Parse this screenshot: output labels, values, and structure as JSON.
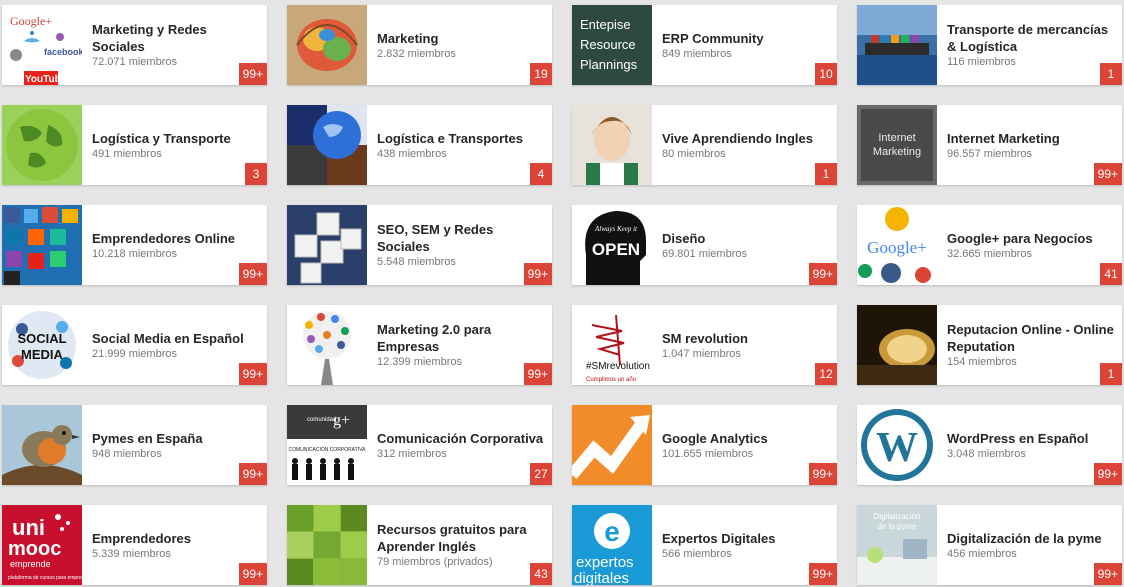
{
  "communities": [
    {
      "name": "Marketing y Redes Sociales",
      "members": "72.071 miembros",
      "badge": "99+",
      "thumb": "social-logos",
      "color": "#ffffff"
    },
    {
      "name": "Marketing",
      "members": "2.832 miembros",
      "badge": "19",
      "thumb": "colorful-brain",
      "color": "#c8a878"
    },
    {
      "name": "ERP Community",
      "members": "849 miembros",
      "badge": "10",
      "thumb": "erp-text",
      "color": "#2e4a3e"
    },
    {
      "name": "Transporte de mercancías & Logística",
      "members": "116 miembros",
      "badge": "1",
      "thumb": "cargo-ship",
      "color": "#3a6fa8"
    },
    {
      "name": "Logística y Transporte",
      "members": "491 miembros",
      "badge": "3",
      "thumb": "green-globe",
      "color": "#6aa83a"
    },
    {
      "name": "Logística e Transportes",
      "members": "438 miembros",
      "badge": "4",
      "thumb": "globe-collage",
      "color": "#3b5aa8"
    },
    {
      "name": "Vive Aprendiendo Ingles",
      "members": "80 miembros",
      "badge": "1",
      "thumb": "woman-portrait",
      "color": "#d9c3a5"
    },
    {
      "name": "Internet Marketing",
      "members": "96.557 miembros",
      "badge": "99+",
      "thumb": "chalkboard",
      "color": "#5a5a5a"
    },
    {
      "name": "Emprendedores Online",
      "members": "10.218 miembros",
      "badge": "99+",
      "thumb": "social-icons",
      "color": "#2a7fc8"
    },
    {
      "name": "SEO, SEM y Redes Sociales",
      "members": "5.548 miembros",
      "badge": "99+",
      "thumb": "cubes",
      "color": "#2b3f6b"
    },
    {
      "name": "Diseño",
      "members": "69.801 miembros",
      "badge": "99+",
      "thumb": "head-open",
      "color": "#ffffff"
    },
    {
      "name": "Google+ para Negocios",
      "members": "32.665 miembros",
      "badge": "41",
      "thumb": "google-plus",
      "color": "#ffffff"
    },
    {
      "name": "Social Media en Español",
      "members": "21.999 miembros",
      "badge": "99+",
      "thumb": "social-media-ball",
      "color": "#ffffff"
    },
    {
      "name": "Marketing 2.0 para Empresas",
      "members": "12.399 miembros",
      "badge": "99+",
      "thumb": "icon-tree",
      "color": "#ffffff"
    },
    {
      "name": "SM revolution",
      "members": "1.047 miembros",
      "badge": "12",
      "thumb": "sm-revolution",
      "color": "#ffffff"
    },
    {
      "name": "Reputacion Online - Online Reputation",
      "members": "154 miembros",
      "badge": "1",
      "thumb": "pocket-watch",
      "color": "#6b4a1a"
    },
    {
      "name": "Pymes en España",
      "members": "948 miembros",
      "badge": "99+",
      "thumb": "robin-bird",
      "color": "#a9c7d8"
    },
    {
      "name": "Comunicación Corporativa",
      "members": "312 miembros",
      "badge": "27",
      "thumb": "silhouettes",
      "color": "#ffffff"
    },
    {
      "name": "Google Analytics",
      "members": "101.655 miembros",
      "badge": "99+",
      "thumb": "analytics-arrow",
      "color": "#f28c2b"
    },
    {
      "name": "WordPress en Español",
      "members": "3.048 miembros",
      "badge": "99+",
      "thumb": "wordpress-logo",
      "color": "#ffffff"
    },
    {
      "name": "Emprendedores",
      "members": "5.339 miembros",
      "badge": "99+",
      "thumb": "unimooc",
      "color": "#c8102e"
    },
    {
      "name": "Recursos gratuitos para Aprender Inglés",
      "members": "79 miembros (privados)",
      "badge": "43",
      "thumb": "green-grid",
      "color": "#8ab83a"
    },
    {
      "name": "Expertos Digitales",
      "members": "566 miembros",
      "badge": "99+",
      "thumb": "expertos-digitales",
      "color": "#1a9ad6"
    },
    {
      "name": "Digitalización de la pyme",
      "members": "456 miembros",
      "badge": "99+",
      "thumb": "office-room",
      "color": "#dfe8ea"
    }
  ],
  "thumb_text": {
    "google": "Google+",
    "facebook": "facebook",
    "youtube": "YouTube",
    "erp1": "Entepise",
    "erp2": "Resource",
    "erp3": "Plannings",
    "internet": "Internet",
    "marketing": "Marketing",
    "open": "OPEN",
    "always": "Always Keep it",
    "googleplus": "Google+",
    "social": "SOCIAL",
    "media": "MEDIA",
    "smrev": "#SMrevolution",
    "cumplimos": "Cumplimos un año",
    "comunicacion": "COMUNICACIÓN CORPORATIVA",
    "uni": "uni",
    "mooc": "mooc",
    "emprende": "emprende",
    "plataforma": "plataforma de cursos para emprendedores",
    "expertos": "expertos",
    "digitales": "digitales",
    "digital1": "Digitalización",
    "digital2": "de la pyme"
  }
}
